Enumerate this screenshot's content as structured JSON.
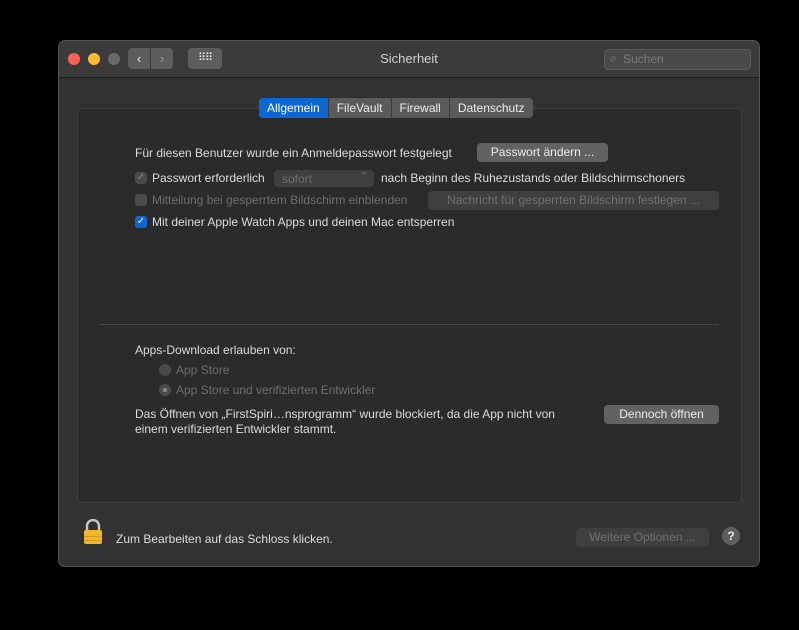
{
  "window": {
    "title": "Sicherheit"
  },
  "toolbar": {
    "back": "‹",
    "forward": "›",
    "grid": "⠿⠿",
    "search_placeholder": "Suchen"
  },
  "tabs": [
    {
      "label": "Allgemein",
      "active": true
    },
    {
      "label": "FileVault",
      "active": false
    },
    {
      "label": "Firewall",
      "active": false
    },
    {
      "label": "Datenschutz",
      "active": false
    }
  ],
  "general": {
    "password_set_text": "Für diesen Benutzer wurde ein Anmeldepasswort festgelegt",
    "change_password_button": "Passwort ändern ...",
    "require_password_label": "Passwort erforderlich",
    "require_password_value": "sofort",
    "require_password_suffix": "nach Beginn des Ruhezustands oder Bildschirmschoners",
    "show_message_label": "Mitteilung bei gesperrtem Bildschirm einblenden",
    "set_lock_message_button": "Nachricht für gesperrten Bildschirm festlegen ...",
    "apple_watch_label": "Mit deiner Apple Watch Apps und deinen Mac entsperren"
  },
  "downloads": {
    "heading": "Apps-Download erlauben von:",
    "options": [
      {
        "label": "App Store",
        "selected": false
      },
      {
        "label": "App Store und verifizierten Entwickler",
        "selected": true
      }
    ],
    "blocked_line1": "Das Öffnen von „FirstSpiri…nsprogramm“ wurde blockiert, da die App nicht von",
    "blocked_line2": "einem verifizierten Entwickler stammt.",
    "open_anyway_button": "Dennoch öffnen"
  },
  "footer": {
    "lock_text": "Zum Bearbeiten auf das Schloss klicken.",
    "more_options_button": "Weitere Optionen ...",
    "help": "?"
  }
}
